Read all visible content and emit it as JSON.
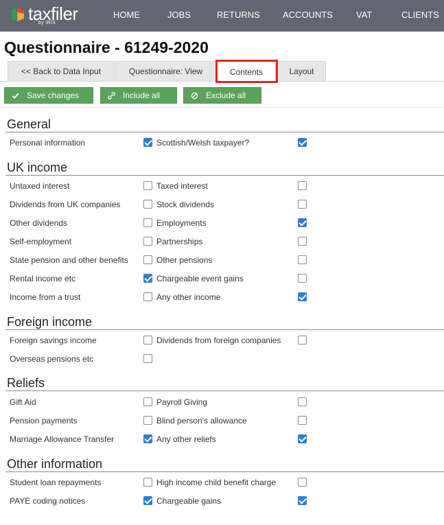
{
  "nav": {
    "logo_text": "taxfiler",
    "logo_sub": "by IRIS",
    "items": [
      "HOME",
      "JOBS",
      "RETURNS",
      "ACCOUNTS",
      "VAT",
      "CLIENTS"
    ]
  },
  "page": {
    "title": "Questionnaire - 61249-2020"
  },
  "tabs": [
    {
      "label": "<< Back to Data Input"
    },
    {
      "label": "Questionnaire: View"
    },
    {
      "label": "Contents",
      "active": true
    },
    {
      "label": "Layout"
    }
  ],
  "toolbar": {
    "save_label": "Save changes",
    "include_label": "Include all",
    "exclude_label": "Exclude all"
  },
  "sections": [
    {
      "title": "General",
      "rows": [
        {
          "left": {
            "label": "Personal information",
            "checked": true
          },
          "right": {
            "label": "Scottish/Welsh taxpayer?",
            "checked": true
          }
        }
      ]
    },
    {
      "title": "UK income",
      "rows": [
        {
          "left": {
            "label": "Untaxed interest",
            "checked": false
          },
          "right": {
            "label": "Taxed interest",
            "checked": false
          }
        },
        {
          "left": {
            "label": "Dividends from UK companies",
            "checked": false
          },
          "right": {
            "label": "Stock dividends",
            "checked": false
          }
        },
        {
          "left": {
            "label": "Other dividends",
            "checked": false
          },
          "right": {
            "label": "Employments",
            "checked": true
          }
        },
        {
          "left": {
            "label": "Self-employment",
            "checked": false
          },
          "right": {
            "label": "Partnerships",
            "checked": false
          }
        },
        {
          "left": {
            "label": "State pension and other benefits",
            "checked": false
          },
          "right": {
            "label": "Other pensions",
            "checked": false
          }
        },
        {
          "left": {
            "label": "Rental income etc",
            "checked": true
          },
          "right": {
            "label": "Chargeable event gains",
            "checked": false
          }
        },
        {
          "left": {
            "label": "Income from a trust",
            "checked": false
          },
          "right": {
            "label": "Any other income",
            "checked": true
          }
        }
      ]
    },
    {
      "title": "Foreign income",
      "rows": [
        {
          "left": {
            "label": "Foreign savings income",
            "checked": false
          },
          "right": {
            "label": "Dividends from foreign companies",
            "checked": false
          }
        },
        {
          "left": {
            "label": "Overseas pensions etc",
            "checked": false
          },
          "right": null
        }
      ]
    },
    {
      "title": "Reliefs",
      "rows": [
        {
          "left": {
            "label": "Gift Aid",
            "checked": false
          },
          "right": {
            "label": "Payroll Giving",
            "checked": false
          }
        },
        {
          "left": {
            "label": "Pension payments",
            "checked": false
          },
          "right": {
            "label": "Blind person's allowance",
            "checked": false
          }
        },
        {
          "left": {
            "label": "Marriage Allowance Transfer",
            "checked": true
          },
          "right": {
            "label": "Any other reliefs",
            "checked": true
          }
        }
      ]
    },
    {
      "title": "Other information",
      "rows": [
        {
          "left": {
            "label": "Student loan repayments",
            "checked": false
          },
          "right": {
            "label": "High income child benefit charge",
            "checked": false
          }
        },
        {
          "left": {
            "label": "PAYE coding notices",
            "checked": true
          },
          "right": {
            "label": "Chargeable gains",
            "checked": true
          }
        }
      ]
    }
  ],
  "colors": {
    "nav_bg": "#606770",
    "button_green": "#5ba35b",
    "checkbox_blue": "#2d7fd6",
    "highlight_red": "#e0281d"
  }
}
